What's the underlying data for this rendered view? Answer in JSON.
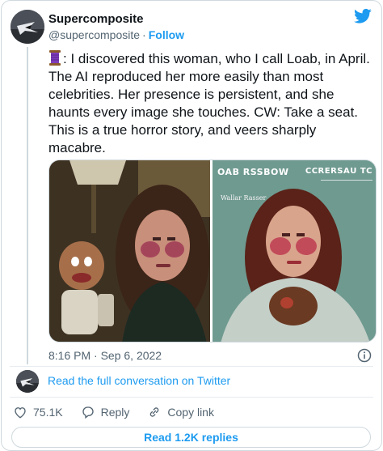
{
  "author": {
    "name": "Supercomposite",
    "handle": "@supercomposite",
    "follow_label": "Follow",
    "separator": "·"
  },
  "tweet": {
    "text": ": I discovered this woman, who I call Loab, in April. The AI reproduced her more easily than most celebrities. Her presence is persistent, and she haunts every image she touches. CW: Take a seat. This is a true horror story, and veers sharply macabre.",
    "emoji_icon": "thread-spool-icon"
  },
  "media": {
    "right_image": {
      "title_left": "OAB RSSBOW",
      "title_right": "ССRЕRSАU ТС",
      "subtitle": "Wallar Rasser"
    }
  },
  "timestamp": "8:16 PM · Sep 6, 2022",
  "conversation_link": "Read the full conversation on Twitter",
  "actions": {
    "like_count": "75.1K",
    "reply_label": "Reply",
    "copy_link_label": "Copy link"
  },
  "read_replies_label": "Read 1.2K replies",
  "colors": {
    "accent": "#1d9bf0",
    "text": "#0f1419",
    "muted": "#536471",
    "border": "#cfd9de"
  }
}
